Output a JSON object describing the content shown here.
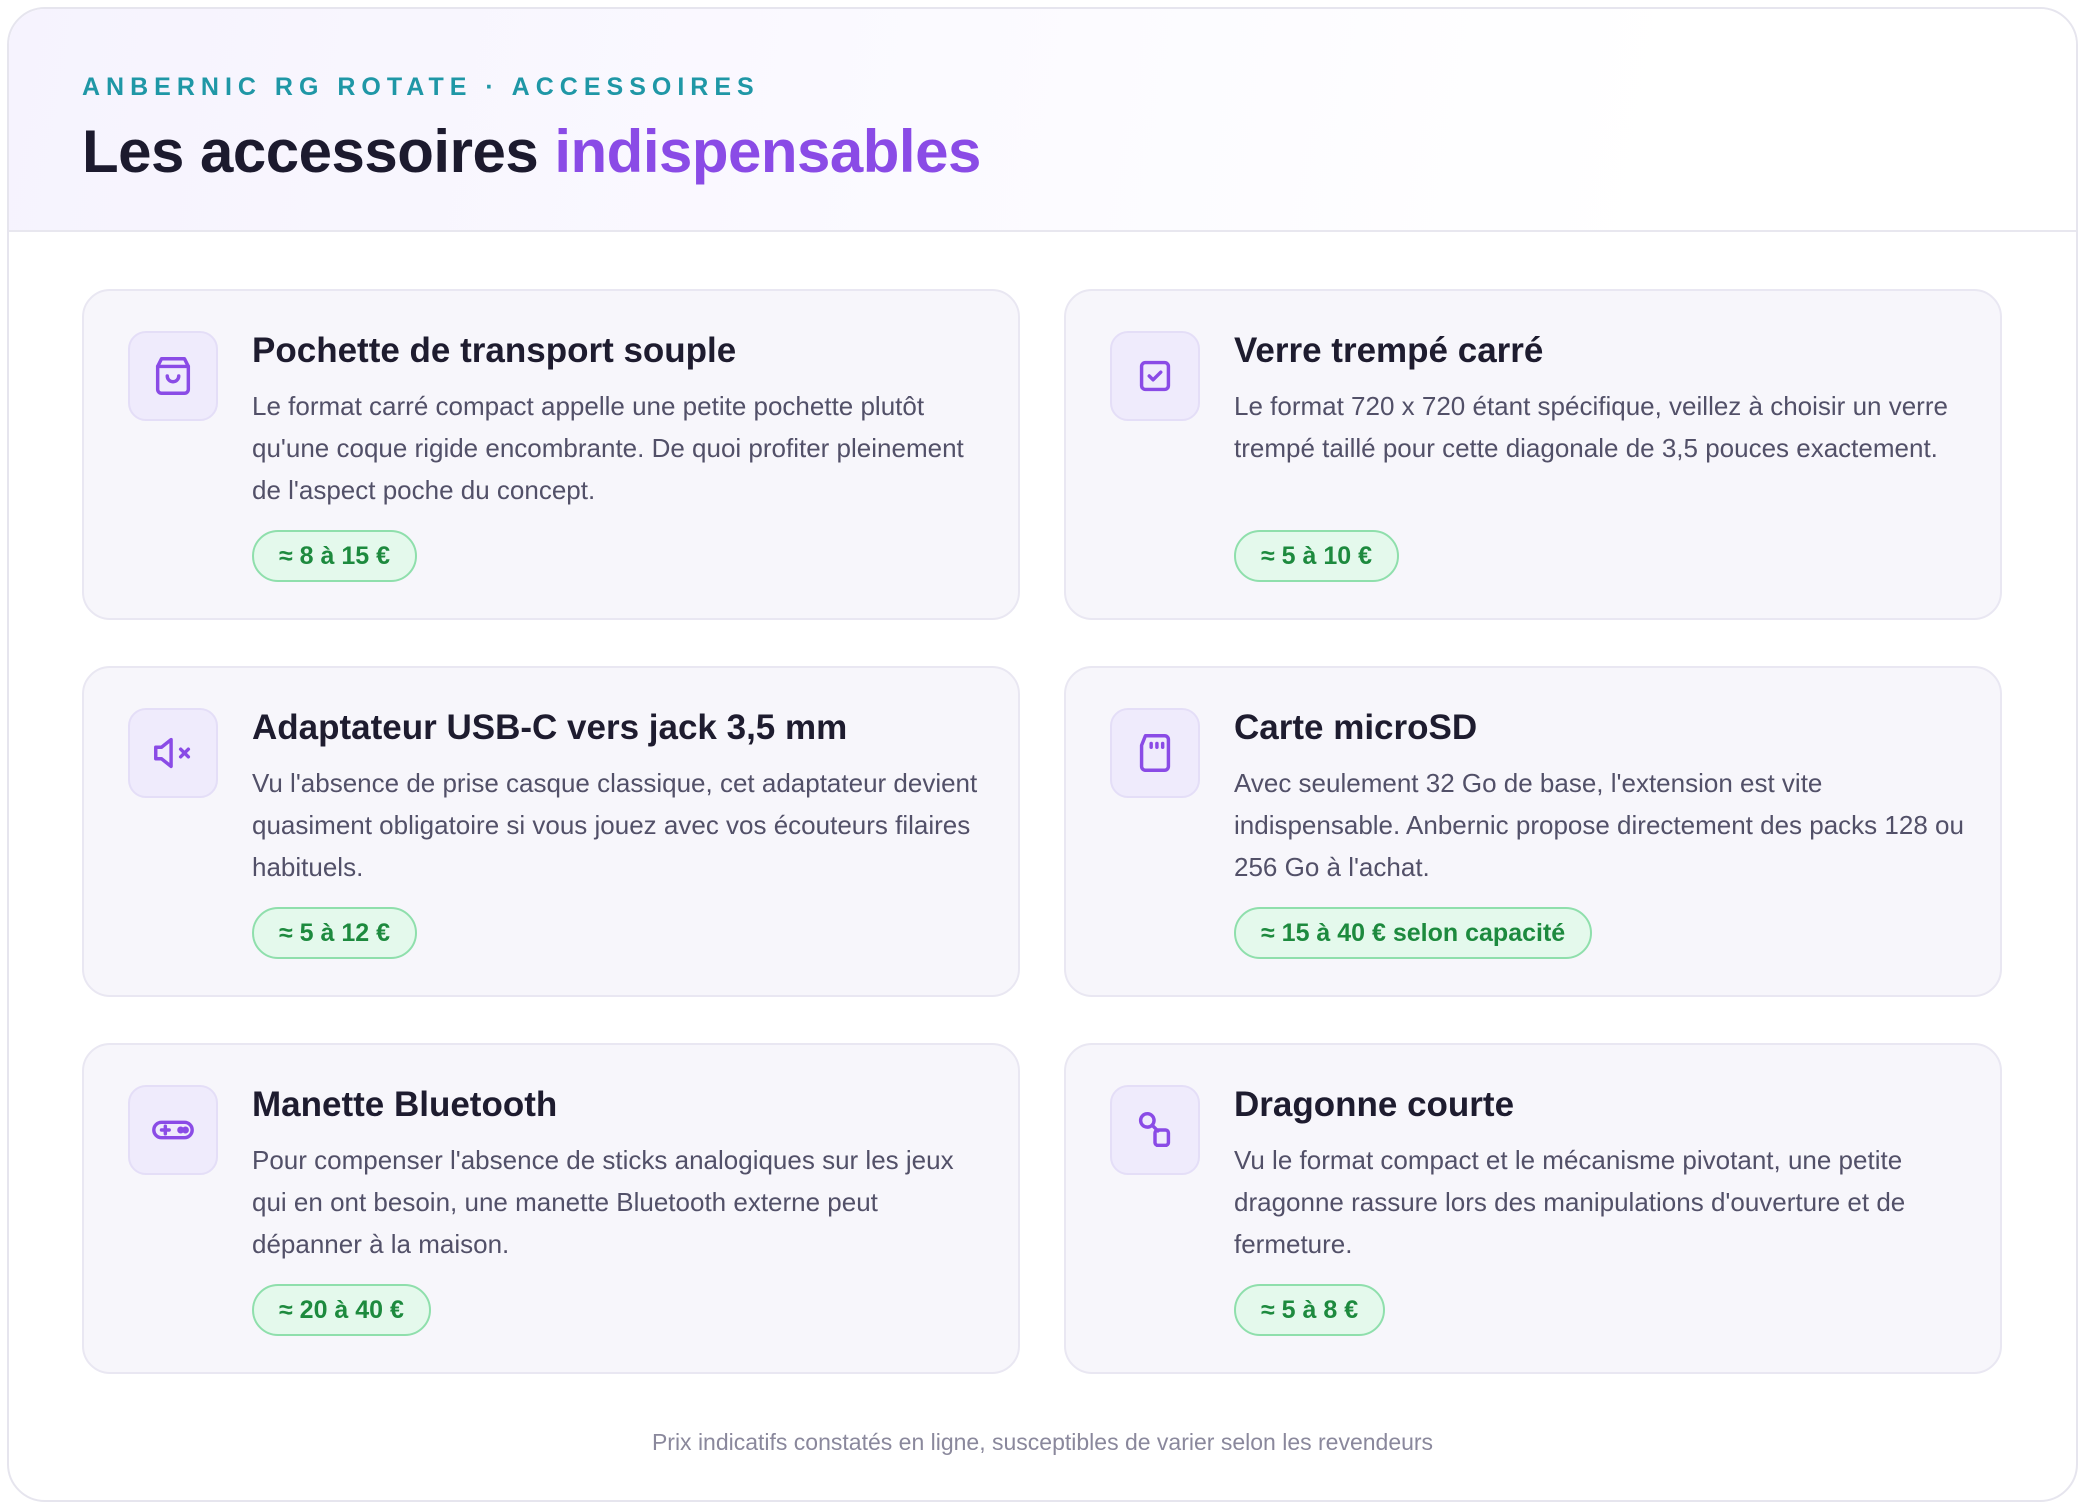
{
  "header": {
    "eyebrow": "ANBERNIC RG ROTATE · ACCESSOIRES",
    "title_main": "Les accessoires ",
    "title_accent": "indispensables"
  },
  "colors": {
    "accent": "#8a4be6",
    "eyebrow": "#1f97a6",
    "price_text": "#1d8a3e",
    "price_bg": "#e4f9ec"
  },
  "cards": [
    {
      "icon": "bag-icon",
      "title": "Pochette de transport souple",
      "description": "Le format carré compact appelle une petite pochette plutôt qu'une coque rigide encombrante. De quoi profiter pleinement de l'aspect poche du concept.",
      "price": "≈ 8 à 15 €"
    },
    {
      "icon": "screen-check-icon",
      "title": "Verre trempé carré",
      "description": "Le format 720 x 720 étant spécifique, veillez à choisir un verre trempé taillé pour cette diagonale de 3,5 pouces exactement.",
      "price": "≈ 5 à 10 €"
    },
    {
      "icon": "speaker-mute-icon",
      "title": "Adaptateur USB-C vers jack 3,5 mm",
      "description": "Vu l'absence de prise casque classique, cet adaptateur devient quasiment obligatoire si vous jouez avec vos écouteurs filaires habituels.",
      "price": "≈ 5 à 12 €"
    },
    {
      "icon": "sd-card-icon",
      "title": "Carte microSD",
      "description": "Avec seulement 32 Go de base, l'extension est vite indispensable. Anbernic propose directement des packs 128 ou 256 Go à l'achat.",
      "price": "≈ 15 à 40 € selon capacité"
    },
    {
      "icon": "gamepad-icon",
      "title": "Manette Bluetooth",
      "description": "Pour compenser l'absence de sticks analogiques sur les jeux qui en ont besoin, une manette Bluetooth externe peut dépanner à la maison.",
      "price": "≈ 20 à 40 €"
    },
    {
      "icon": "strap-icon",
      "title": "Dragonne courte",
      "description": "Vu le format compact et le mécanisme pivotant, une petite dragonne rassure lors des manipulations d'ouverture et de fermeture.",
      "price": "≈ 5 à 8 €"
    }
  ],
  "footnote": "Prix indicatifs constatés en ligne, susceptibles de varier selon les revendeurs"
}
